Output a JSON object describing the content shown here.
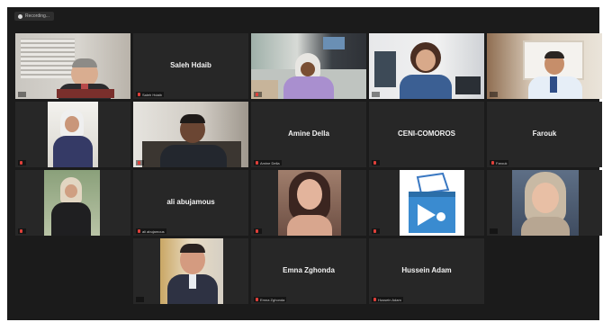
{
  "recording": {
    "label": "Recording..."
  },
  "tiles": [
    {
      "name": "",
      "label": "",
      "video": "man-blinds-office",
      "muted": false
    },
    {
      "name": "Saleh Hdaib",
      "label": "Saleh Hdaib",
      "video": "",
      "muted": true
    },
    {
      "name": "",
      "label": "",
      "video": "woman-hijab-office",
      "muted": true
    },
    {
      "name": "",
      "label": "",
      "video": "woman-dark-hair-office",
      "muted": false
    },
    {
      "name": "",
      "label": "",
      "video": "man-glasses-office",
      "muted": false
    },
    {
      "name": "",
      "label": "",
      "video": "woman-hijab-room",
      "muted": true
    },
    {
      "name": "",
      "label": "",
      "video": "man-desk-office",
      "muted": true
    },
    {
      "name": "Amine Della",
      "label": "Amine Della",
      "video": "",
      "muted": true
    },
    {
      "name": "CENI-COMOROS",
      "label": "",
      "video": "",
      "muted": true
    },
    {
      "name": "Farouk",
      "label": "Farouk",
      "video": "",
      "muted": true
    },
    {
      "name": "",
      "label": "",
      "video": "woman-hijab-garden",
      "muted": true
    },
    {
      "name": "ali abujamous",
      "label": "ali abujamous",
      "video": "",
      "muted": true
    },
    {
      "name": "",
      "label": "",
      "video": "woman-long-hair-portrait",
      "muted": true
    },
    {
      "name": "",
      "label": "",
      "video": "ballot-box-logo",
      "muted": true
    },
    {
      "name": "",
      "label": "",
      "video": "woman-hijab-portrait",
      "muted": false
    },
    {
      "name": "",
      "label": "",
      "video": "man-suit-portrait",
      "muted": false
    },
    {
      "name": "Emna Zghonda",
      "label": "Emna Zghonda",
      "video": "",
      "muted": true
    },
    {
      "name": "Hussein Adam",
      "label": "Hussein Adam",
      "video": "",
      "muted": true
    }
  ]
}
